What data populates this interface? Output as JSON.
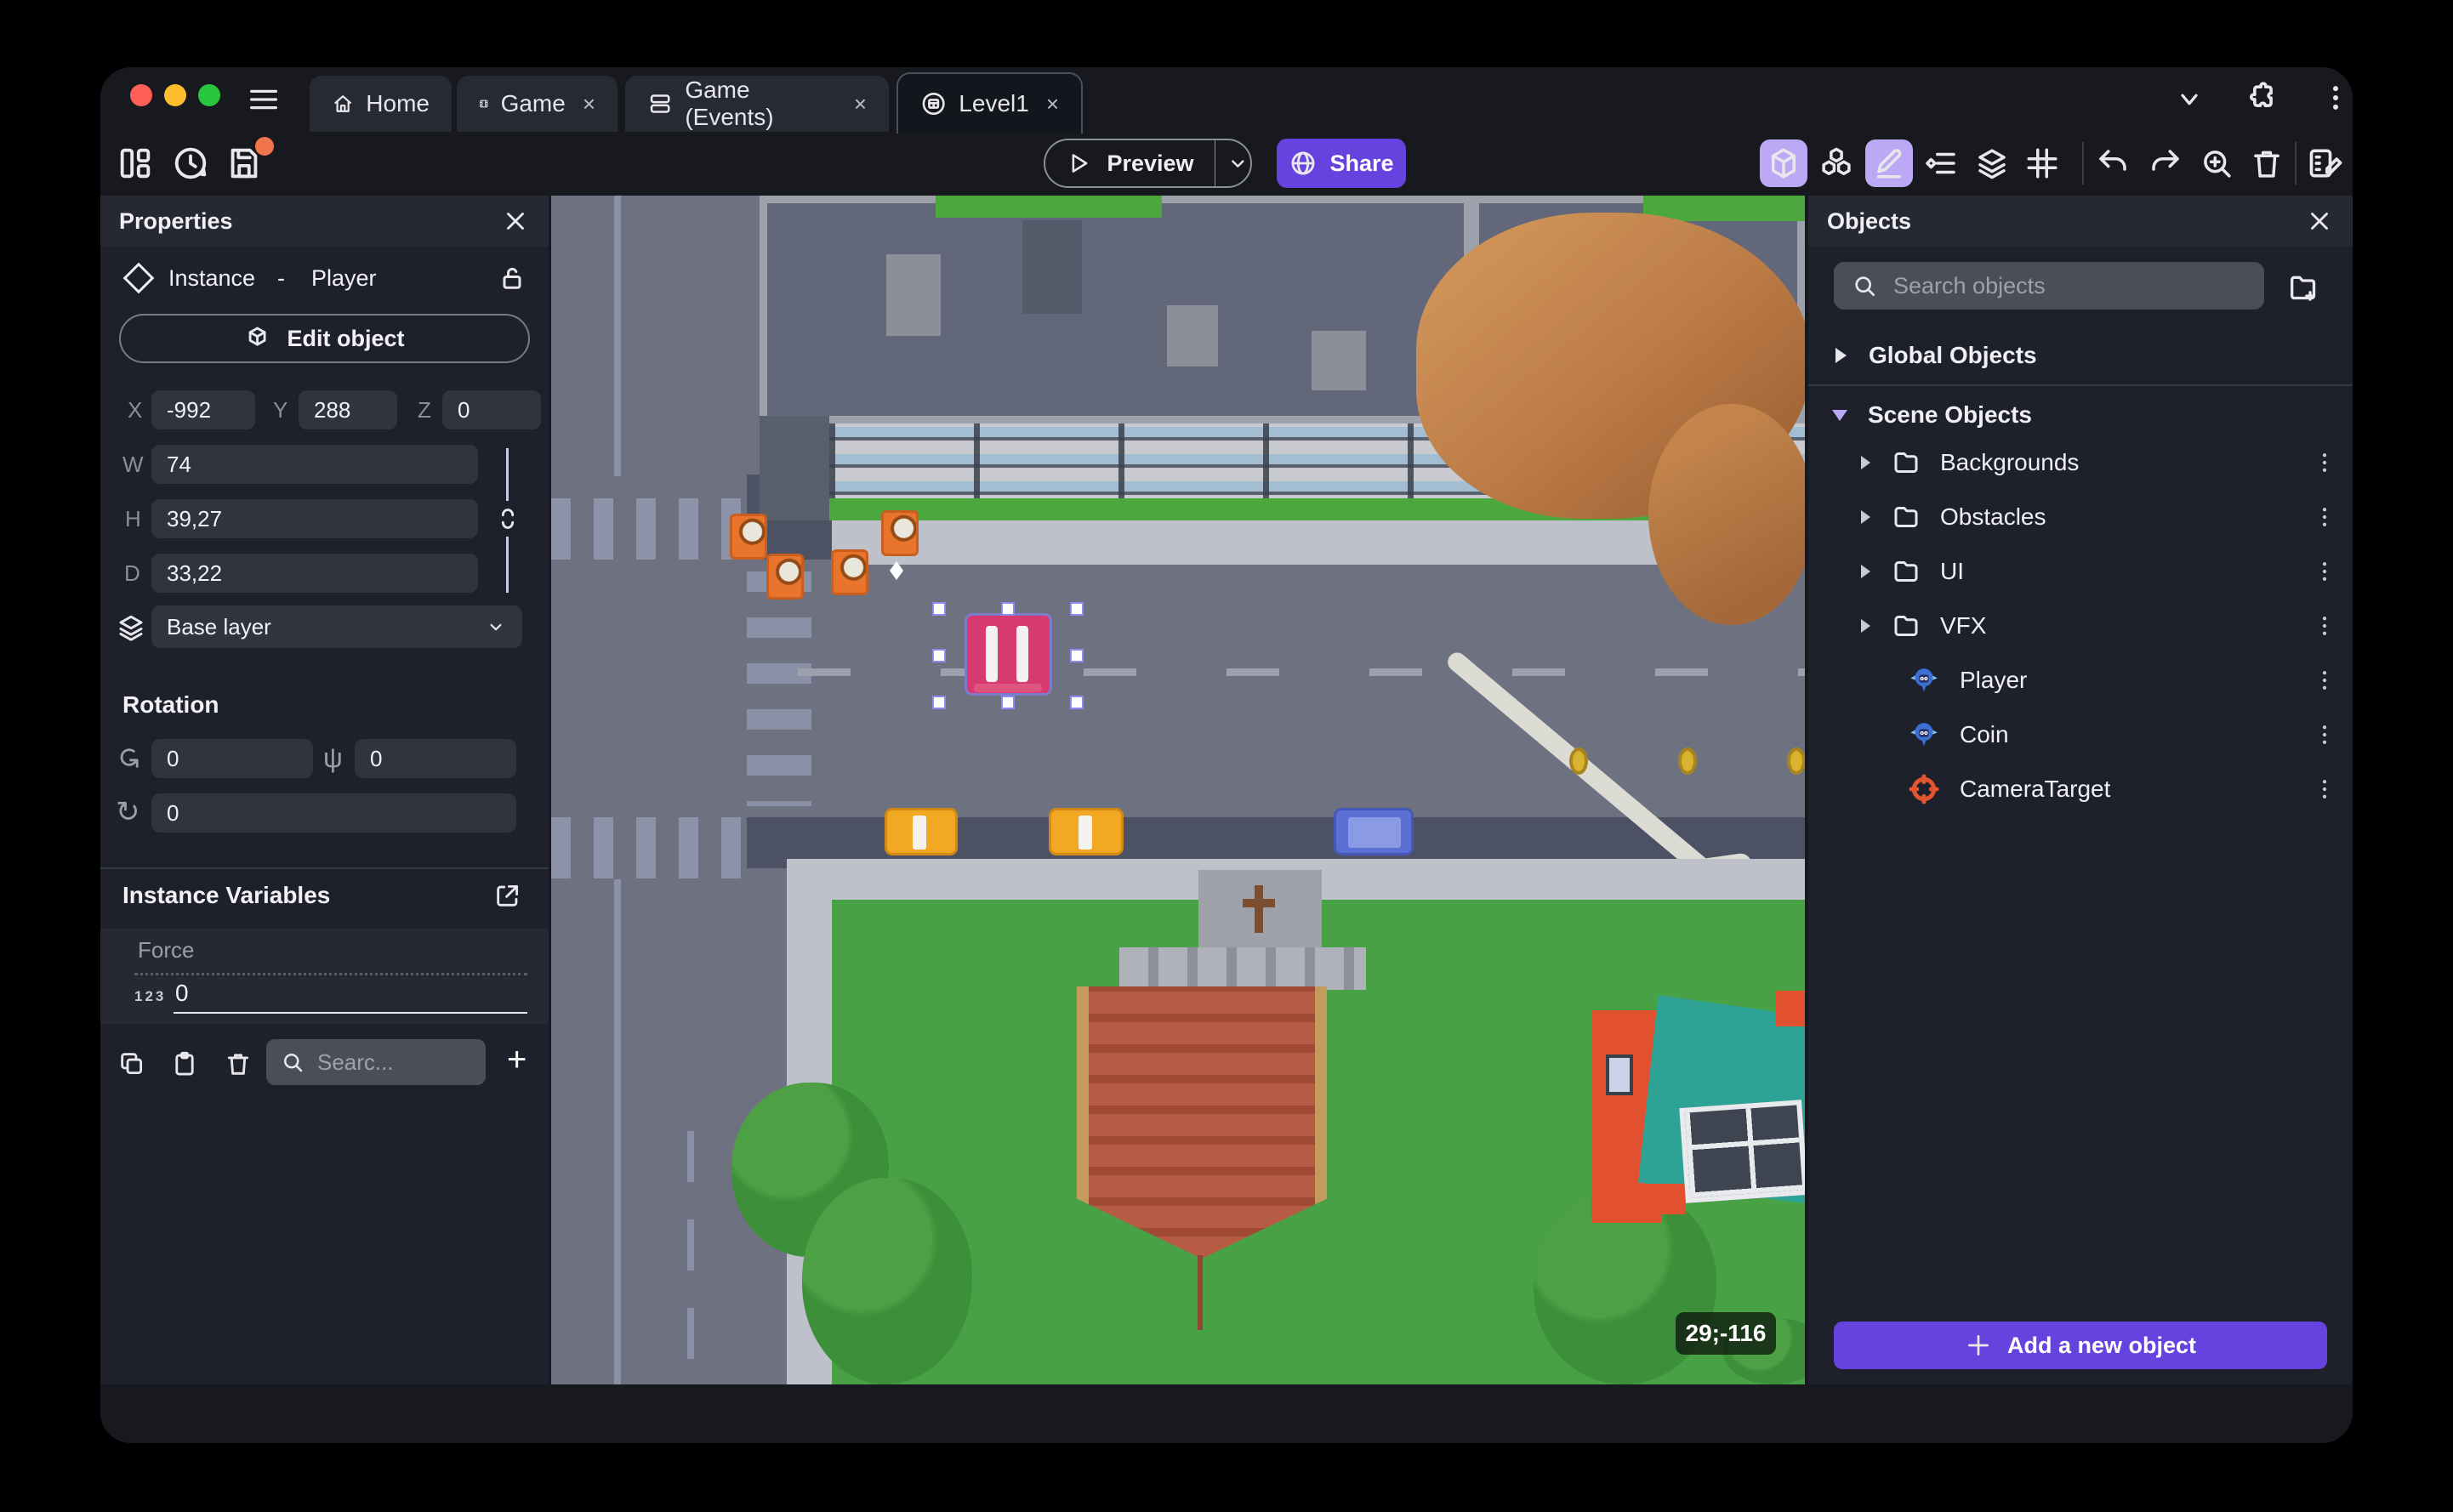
{
  "tabs": {
    "items": [
      {
        "label": "Home"
      },
      {
        "label": "Game"
      },
      {
        "label": "Game (Events)"
      },
      {
        "label": "Level1"
      }
    ]
  },
  "toolbar": {
    "preview_label": "Preview",
    "share_label": "Share"
  },
  "properties": {
    "title": "Properties",
    "instance_label": "Instance",
    "separator": "-",
    "object_name": "Player",
    "edit_object_label": "Edit object",
    "x_label": "X",
    "x_value": "-992",
    "y_label": "Y",
    "y_value": "288",
    "z_label": "Z",
    "z_value": "0",
    "w_label": "W",
    "w_value": "74",
    "h_label": "H",
    "h_value": "39,27",
    "d_label": "D",
    "d_value": "33,22",
    "layer_value": "Base layer",
    "rotation_title": "Rotation",
    "rot_x": "0",
    "rot_y": "0",
    "rot_z": "0",
    "variables_title": "Instance Variables",
    "variable_name": "Force",
    "variable_type": "123",
    "variable_value": "0",
    "search_placeholder": "Searc...",
    "add_label": "+"
  },
  "objects": {
    "title": "Objects",
    "search_placeholder": "Search objects",
    "global_group": "Global Objects",
    "scene_group": "Scene Objects",
    "tree": [
      {
        "label": "Backgrounds",
        "icon": "folder-icon"
      },
      {
        "label": "Obstacles",
        "icon": "folder-icon"
      },
      {
        "label": "UI",
        "icon": "folder-icon"
      },
      {
        "label": "VFX",
        "icon": "folder-icon"
      },
      {
        "label": "Player",
        "icon": "monkey-icon"
      },
      {
        "label": "Coin",
        "icon": "monkey-icon"
      },
      {
        "label": "CameraTarget",
        "icon": "target-icon"
      }
    ],
    "add_button_label": "Add a new object"
  },
  "canvas": {
    "coords_badge": "29;-116"
  },
  "colors": {
    "accent": "#6642DE",
    "accent_light": "#BCA9F5",
    "road": "#6E7280",
    "road_dark": "#4C5264",
    "sidewalk": "#BEC1CA",
    "grass": "#48A145",
    "brick": "#B85B44",
    "teal_roof": "#2EA395",
    "cone_orange": "#E8752B",
    "selection_pink": "#D63A6E",
    "taxi_yellow": "#F2A822",
    "car_blue": "#5B6FD4",
    "unsaved_badge": "#F2744B"
  }
}
